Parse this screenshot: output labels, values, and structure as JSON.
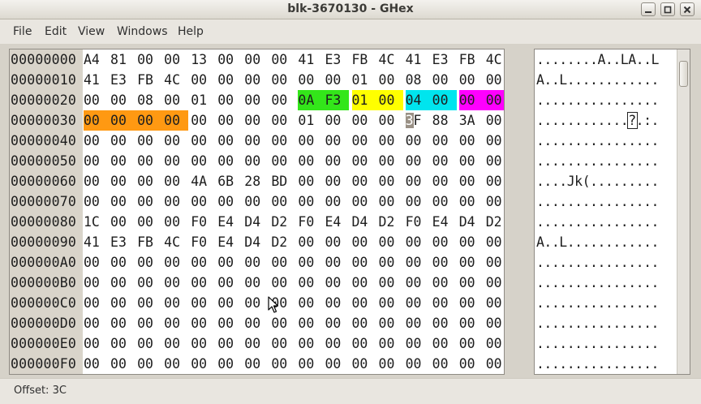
{
  "window": {
    "title": "blk-3670130 - GHex"
  },
  "menubar": {
    "items": [
      {
        "label": "File"
      },
      {
        "label": "Edit"
      },
      {
        "label": "View"
      },
      {
        "label": "Windows"
      },
      {
        "label": "Help"
      }
    ]
  },
  "hex": {
    "rows": [
      {
        "offset": "00000000",
        "bytes": [
          "A4",
          "81",
          "00",
          "00",
          "13",
          "00",
          "00",
          "00",
          "41",
          "E3",
          "FB",
          "4C",
          "41",
          "E3",
          "FB",
          "4C"
        ]
      },
      {
        "offset": "00000010",
        "bytes": [
          "41",
          "E3",
          "FB",
          "4C",
          "00",
          "00",
          "00",
          "00",
          "00",
          "00",
          "01",
          "00",
          "08",
          "00",
          "00",
          "00"
        ]
      },
      {
        "offset": "00000020",
        "bytes": [
          "00",
          "00",
          "08",
          "00",
          "01",
          "00",
          "00",
          "00",
          "0A",
          "F3",
          "01",
          "00",
          "04",
          "00",
          "00",
          "00"
        ]
      },
      {
        "offset": "00000030",
        "bytes": [
          "00",
          "00",
          "00",
          "00",
          "00",
          "00",
          "00",
          "00",
          "01",
          "00",
          "00",
          "00",
          "3F",
          "88",
          "3A",
          "00"
        ]
      },
      {
        "offset": "00000040",
        "bytes": [
          "00",
          "00",
          "00",
          "00",
          "00",
          "00",
          "00",
          "00",
          "00",
          "00",
          "00",
          "00",
          "00",
          "00",
          "00",
          "00"
        ]
      },
      {
        "offset": "00000050",
        "bytes": [
          "00",
          "00",
          "00",
          "00",
          "00",
          "00",
          "00",
          "00",
          "00",
          "00",
          "00",
          "00",
          "00",
          "00",
          "00",
          "00"
        ]
      },
      {
        "offset": "00000060",
        "bytes": [
          "00",
          "00",
          "00",
          "00",
          "4A",
          "6B",
          "28",
          "BD",
          "00",
          "00",
          "00",
          "00",
          "00",
          "00",
          "00",
          "00"
        ]
      },
      {
        "offset": "00000070",
        "bytes": [
          "00",
          "00",
          "00",
          "00",
          "00",
          "00",
          "00",
          "00",
          "00",
          "00",
          "00",
          "00",
          "00",
          "00",
          "00",
          "00"
        ]
      },
      {
        "offset": "00000080",
        "bytes": [
          "1C",
          "00",
          "00",
          "00",
          "F0",
          "E4",
          "D4",
          "D2",
          "F0",
          "E4",
          "D4",
          "D2",
          "F0",
          "E4",
          "D4",
          "D2"
        ]
      },
      {
        "offset": "00000090",
        "bytes": [
          "41",
          "E3",
          "FB",
          "4C",
          "F0",
          "E4",
          "D4",
          "D2",
          "00",
          "00",
          "00",
          "00",
          "00",
          "00",
          "00",
          "00"
        ]
      },
      {
        "offset": "000000A0",
        "bytes": [
          "00",
          "00",
          "00",
          "00",
          "00",
          "00",
          "00",
          "00",
          "00",
          "00",
          "00",
          "00",
          "00",
          "00",
          "00",
          "00"
        ]
      },
      {
        "offset": "000000B0",
        "bytes": [
          "00",
          "00",
          "00",
          "00",
          "00",
          "00",
          "00",
          "00",
          "00",
          "00",
          "00",
          "00",
          "00",
          "00",
          "00",
          "00"
        ]
      },
      {
        "offset": "000000C0",
        "bytes": [
          "00",
          "00",
          "00",
          "00",
          "00",
          "00",
          "00",
          "00",
          "00",
          "00",
          "00",
          "00",
          "00",
          "00",
          "00",
          "00"
        ]
      },
      {
        "offset": "000000D0",
        "bytes": [
          "00",
          "00",
          "00",
          "00",
          "00",
          "00",
          "00",
          "00",
          "00",
          "00",
          "00",
          "00",
          "00",
          "00",
          "00",
          "00"
        ]
      },
      {
        "offset": "000000E0",
        "bytes": [
          "00",
          "00",
          "00",
          "00",
          "00",
          "00",
          "00",
          "00",
          "00",
          "00",
          "00",
          "00",
          "00",
          "00",
          "00",
          "00"
        ]
      },
      {
        "offset": "000000F0",
        "bytes": [
          "00",
          "00",
          "00",
          "00",
          "00",
          "00",
          "00",
          "00",
          "00",
          "00",
          "00",
          "00",
          "00",
          "00",
          "00",
          "00"
        ]
      }
    ],
    "highlights": [
      {
        "row": 2,
        "from": 8,
        "to": 9,
        "color": "#33e61a"
      },
      {
        "row": 2,
        "from": 10,
        "to": 11,
        "color": "#ffff00"
      },
      {
        "row": 2,
        "from": 12,
        "to": 13,
        "color": "#00e5ee"
      },
      {
        "row": 2,
        "from": 14,
        "to": 15,
        "color": "#ff00ff"
      },
      {
        "row": 3,
        "from": 0,
        "to": 3,
        "color": "#ff9912"
      }
    ],
    "cursor": {
      "row": 3,
      "col": 12,
      "color": "#9a9186"
    }
  },
  "ascii": {
    "rows": [
      "........A..LA..L",
      "A..L............",
      "................",
      "............?.:.",
      "................",
      "................",
      "....Jk(.........",
      "................",
      "................",
      "A..L............",
      "................",
      "................",
      "................",
      "................",
      "................",
      "................"
    ],
    "cursor": {
      "row": 3,
      "col": 12
    }
  },
  "statusbar": {
    "text": "Offset: 3C"
  }
}
